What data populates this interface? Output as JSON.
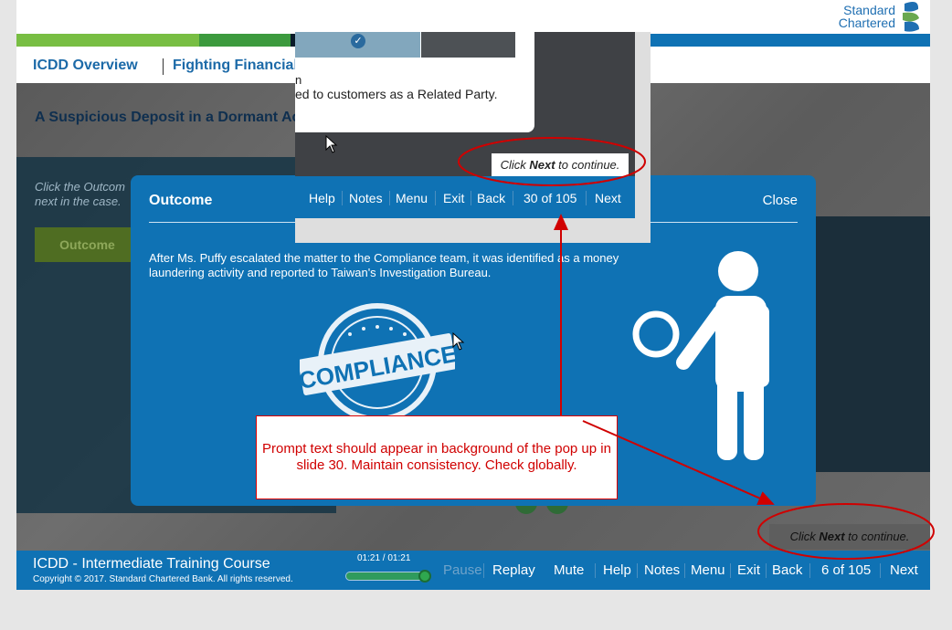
{
  "header": {
    "logo_line1": "Standard",
    "logo_line2": "Chartered",
    "brand_colors": [
      "#78be43",
      "#3c9a3e",
      "#1c6aa8",
      "#0a1b2a",
      "#0f72b4"
    ]
  },
  "nav": {
    "item1": "ICDD Overview",
    "item2": "Fighting Financial C"
  },
  "slide": {
    "title": "A Suspicious Deposit in a Dormant Ac",
    "instruction": "Click the Outcom next in the case.",
    "outcome_button": "Outcome"
  },
  "modal": {
    "title": "Outcome",
    "close": "Close",
    "body": "After Ms. Puffy escalated the matter to the Compliance team, it was identified as a money laundering activity and reported to Taiwan's Investigation Bureau.",
    "stamp_text": "COMPLIANCE"
  },
  "overlay": {
    "text1": "n",
    "text2": "ed to customers as a Related Party.",
    "prompt_pre": "Click ",
    "prompt_bold": "Next",
    "prompt_post": " to continue.",
    "nav": {
      "help": "Help",
      "notes": "Notes",
      "menu": "Menu",
      "exit": "Exit",
      "back": "Back",
      "page": "30 of 105",
      "next": "Next"
    }
  },
  "callout": {
    "text": "Prompt text should appear in background of the pop up in slide 30. Maintain consistency. Check globally."
  },
  "bottom_bar": {
    "course_title": "ICDD - Intermediate Training Course",
    "copyright": "Copyright © 2017. Standard Chartered Bank. All rights reserved.",
    "timer": "01:21 / 01:21",
    "progress": 1.0,
    "pause": "Pause",
    "replay": "Replay",
    "mute": "Mute",
    "help": "Help",
    "notes": "Notes",
    "menu": "Menu",
    "exit": "Exit",
    "back": "Back",
    "page": "6 of 105",
    "next": "Next"
  },
  "bottom_prompt": {
    "pre": "Click ",
    "bold": "Next",
    "post": " to continue."
  },
  "annotation_color": "#d00000"
}
